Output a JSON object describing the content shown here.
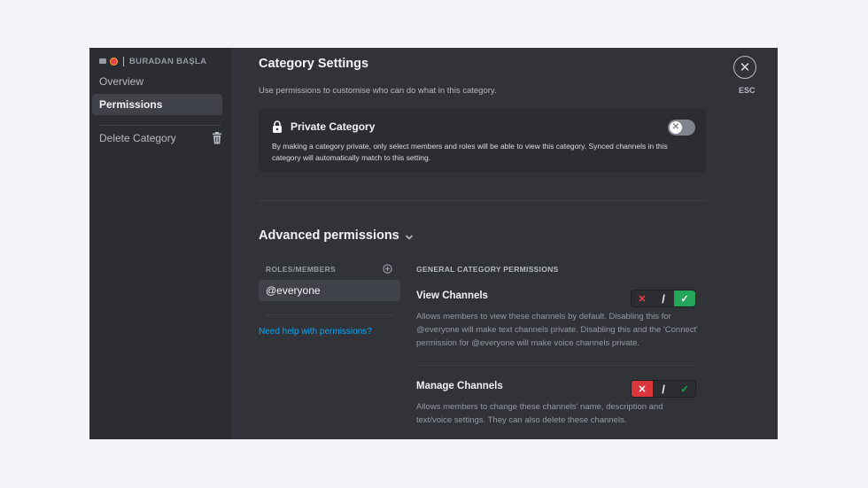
{
  "sidebar": {
    "server_name": "BURADAN BAŞLA",
    "items": [
      {
        "label": "Overview"
      },
      {
        "label": "Permissions"
      },
      {
        "label": "Delete Category"
      }
    ]
  },
  "main": {
    "title": "Category Settings",
    "subtitle": "Use permissions to customise who can do what in this category.",
    "private_category": {
      "title": "Private Category",
      "description": "By making a category private, only select members and roles will be able to view this category. Synced channels in this category will automatically match to this setting.",
      "enabled": false
    },
    "advanced": {
      "title": "Advanced permissions",
      "roles_header": "ROLES/MEMBERS",
      "roles": [
        "@everyone"
      ],
      "help_link": "Need help with permissions?",
      "permissions_header": "GENERAL CATEGORY PERMISSIONS",
      "permissions": [
        {
          "name": "View Channels",
          "description": "Allows members to view these channels by default. Disabling this for @everyone will make text channels private. Disabling this and the 'Connect' permission for @everyone will make voice channels private.",
          "state": "allow",
          "deny_symbol": "✕",
          "separator": "/",
          "allow_symbol": "✓"
        },
        {
          "name": "Manage Channels",
          "description": "Allows members to change these channels' name, description and text/voice settings. They can also delete these channels.",
          "state": "deny",
          "deny_symbol": "✕",
          "separator": "/",
          "allow_symbol": "✓"
        }
      ]
    }
  },
  "close": {
    "icon": "✕",
    "label": "ESC"
  },
  "colors": {
    "accent_link": "#00a8fc",
    "allow": "#23a55a",
    "deny": "#da373c"
  }
}
